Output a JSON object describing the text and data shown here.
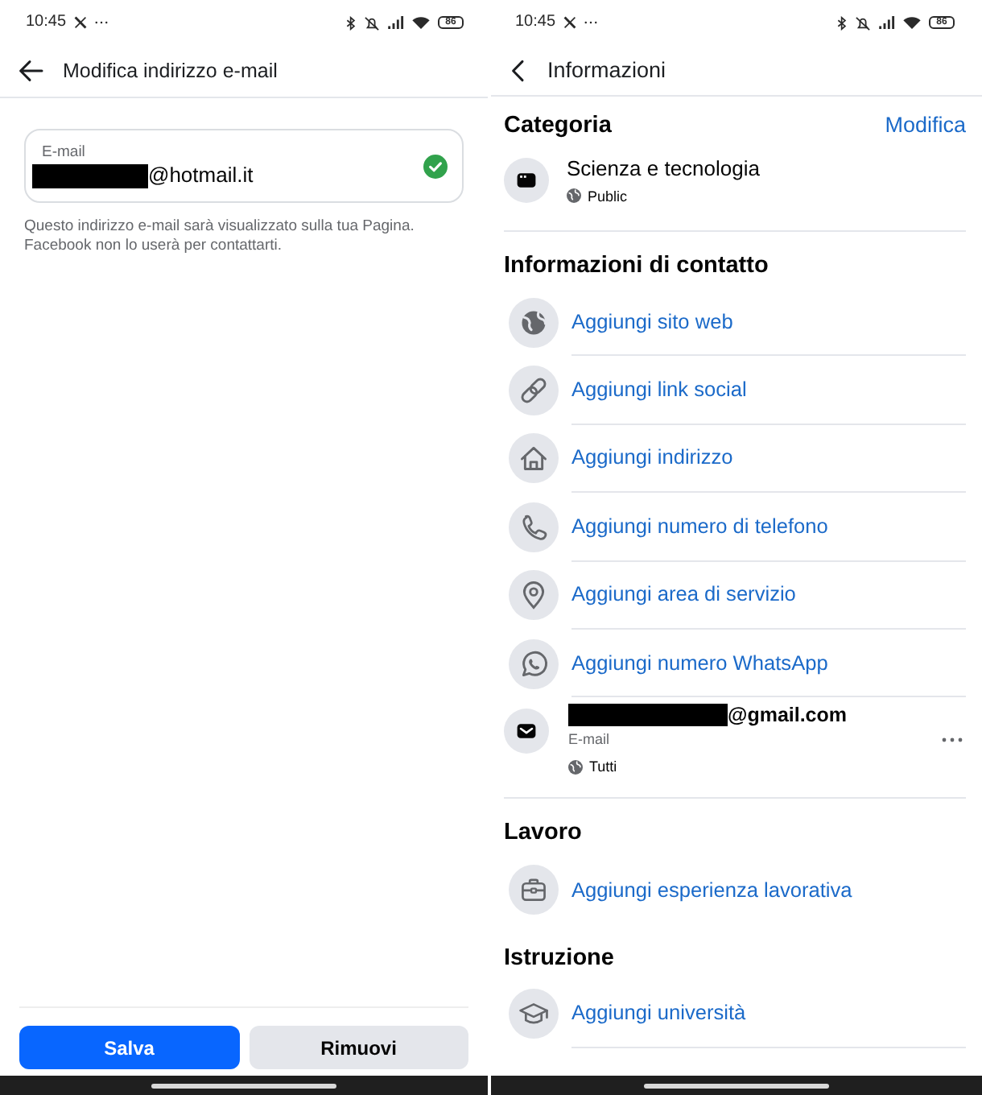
{
  "edit_email_screen": {
    "status_bar": {
      "time": "10:45",
      "battery": "86"
    },
    "header": {
      "title": "Modifica indirizzo e-mail"
    },
    "email_field": {
      "label": "E-mail",
      "value": "@hotmail.it",
      "verified": true
    },
    "helper_text": [
      "Questo indirizzo e-mail sarà visualizzato sulla tua Pagina.",
      "Facebook non lo userà per contattarti."
    ],
    "buttons": [
      {
        "label": "Salva",
        "kind": "primary"
      },
      {
        "label": "Rimuovi",
        "kind": "secondary"
      }
    ]
  },
  "info_screen": {
    "status_bar": {
      "time": "10:45",
      "battery": "86"
    },
    "header": {
      "title": "Informazioni"
    },
    "sections": [
      {
        "title": "Categoria",
        "action": "Modifica",
        "items": [
          {
            "kind": "category",
            "title": "Scienza e tecnologia",
            "audience": "Public"
          }
        ]
      },
      {
        "title": "Informazioni di contatto",
        "items": [
          {
            "kind": "website",
            "label": "Aggiungi sito web"
          },
          {
            "kind": "social",
            "label": "Aggiungi link social"
          },
          {
            "kind": "address",
            "label": "Aggiungi indirizzo"
          },
          {
            "kind": "phone",
            "label": "Aggiungi numero di telefono"
          },
          {
            "kind": "area",
            "label": "Aggiungi area di servizio"
          },
          {
            "kind": "whatsapp",
            "label": "Aggiungi numero WhatsApp"
          },
          {
            "kind": "email",
            "address": "@gmail.com",
            "caption": "E-mail",
            "audience": "Tutti"
          }
        ]
      },
      {
        "title": "Lavoro",
        "items": [
          {
            "kind": "work",
            "label": "Aggiungi esperienza lavorativa"
          }
        ]
      },
      {
        "title": "Istruzione",
        "items": [
          {
            "kind": "university",
            "label": "Aggiungi università"
          }
        ]
      }
    ]
  }
}
